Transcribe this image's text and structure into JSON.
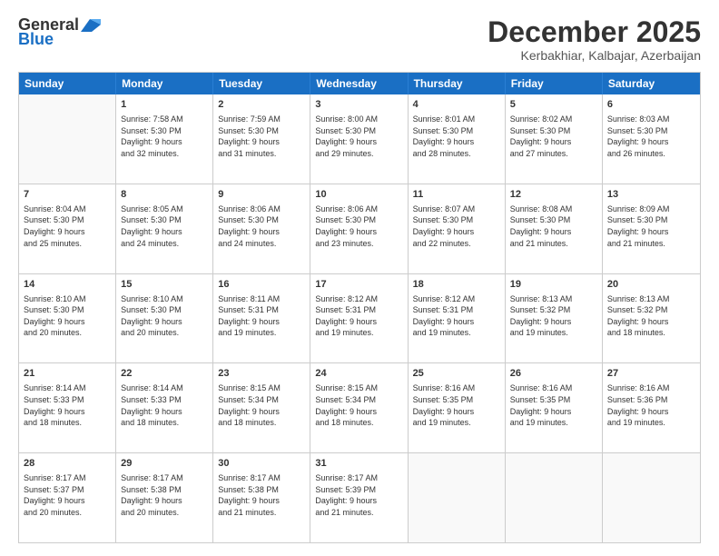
{
  "logo": {
    "general": "General",
    "blue": "Blue"
  },
  "title": "December 2025",
  "subtitle": "Kerbakhiar, Kalbajar, Azerbaijan",
  "days": [
    "Sunday",
    "Monday",
    "Tuesday",
    "Wednesday",
    "Thursday",
    "Friday",
    "Saturday"
  ],
  "weeks": [
    [
      {
        "day": "",
        "info": ""
      },
      {
        "day": "1",
        "info": "Sunrise: 7:58 AM\nSunset: 5:30 PM\nDaylight: 9 hours\nand 32 minutes."
      },
      {
        "day": "2",
        "info": "Sunrise: 7:59 AM\nSunset: 5:30 PM\nDaylight: 9 hours\nand 31 minutes."
      },
      {
        "day": "3",
        "info": "Sunrise: 8:00 AM\nSunset: 5:30 PM\nDaylight: 9 hours\nand 29 minutes."
      },
      {
        "day": "4",
        "info": "Sunrise: 8:01 AM\nSunset: 5:30 PM\nDaylight: 9 hours\nand 28 minutes."
      },
      {
        "day": "5",
        "info": "Sunrise: 8:02 AM\nSunset: 5:30 PM\nDaylight: 9 hours\nand 27 minutes."
      },
      {
        "day": "6",
        "info": "Sunrise: 8:03 AM\nSunset: 5:30 PM\nDaylight: 9 hours\nand 26 minutes."
      }
    ],
    [
      {
        "day": "7",
        "info": "Sunrise: 8:04 AM\nSunset: 5:30 PM\nDaylight: 9 hours\nand 25 minutes."
      },
      {
        "day": "8",
        "info": "Sunrise: 8:05 AM\nSunset: 5:30 PM\nDaylight: 9 hours\nand 24 minutes."
      },
      {
        "day": "9",
        "info": "Sunrise: 8:06 AM\nSunset: 5:30 PM\nDaylight: 9 hours\nand 24 minutes."
      },
      {
        "day": "10",
        "info": "Sunrise: 8:06 AM\nSunset: 5:30 PM\nDaylight: 9 hours\nand 23 minutes."
      },
      {
        "day": "11",
        "info": "Sunrise: 8:07 AM\nSunset: 5:30 PM\nDaylight: 9 hours\nand 22 minutes."
      },
      {
        "day": "12",
        "info": "Sunrise: 8:08 AM\nSunset: 5:30 PM\nDaylight: 9 hours\nand 21 minutes."
      },
      {
        "day": "13",
        "info": "Sunrise: 8:09 AM\nSunset: 5:30 PM\nDaylight: 9 hours\nand 21 minutes."
      }
    ],
    [
      {
        "day": "14",
        "info": "Sunrise: 8:10 AM\nSunset: 5:30 PM\nDaylight: 9 hours\nand 20 minutes."
      },
      {
        "day": "15",
        "info": "Sunrise: 8:10 AM\nSunset: 5:30 PM\nDaylight: 9 hours\nand 20 minutes."
      },
      {
        "day": "16",
        "info": "Sunrise: 8:11 AM\nSunset: 5:31 PM\nDaylight: 9 hours\nand 19 minutes."
      },
      {
        "day": "17",
        "info": "Sunrise: 8:12 AM\nSunset: 5:31 PM\nDaylight: 9 hours\nand 19 minutes."
      },
      {
        "day": "18",
        "info": "Sunrise: 8:12 AM\nSunset: 5:31 PM\nDaylight: 9 hours\nand 19 minutes."
      },
      {
        "day": "19",
        "info": "Sunrise: 8:13 AM\nSunset: 5:32 PM\nDaylight: 9 hours\nand 19 minutes."
      },
      {
        "day": "20",
        "info": "Sunrise: 8:13 AM\nSunset: 5:32 PM\nDaylight: 9 hours\nand 18 minutes."
      }
    ],
    [
      {
        "day": "21",
        "info": "Sunrise: 8:14 AM\nSunset: 5:33 PM\nDaylight: 9 hours\nand 18 minutes."
      },
      {
        "day": "22",
        "info": "Sunrise: 8:14 AM\nSunset: 5:33 PM\nDaylight: 9 hours\nand 18 minutes."
      },
      {
        "day": "23",
        "info": "Sunrise: 8:15 AM\nSunset: 5:34 PM\nDaylight: 9 hours\nand 18 minutes."
      },
      {
        "day": "24",
        "info": "Sunrise: 8:15 AM\nSunset: 5:34 PM\nDaylight: 9 hours\nand 18 minutes."
      },
      {
        "day": "25",
        "info": "Sunrise: 8:16 AM\nSunset: 5:35 PM\nDaylight: 9 hours\nand 19 minutes."
      },
      {
        "day": "26",
        "info": "Sunrise: 8:16 AM\nSunset: 5:35 PM\nDaylight: 9 hours\nand 19 minutes."
      },
      {
        "day": "27",
        "info": "Sunrise: 8:16 AM\nSunset: 5:36 PM\nDaylight: 9 hours\nand 19 minutes."
      }
    ],
    [
      {
        "day": "28",
        "info": "Sunrise: 8:17 AM\nSunset: 5:37 PM\nDaylight: 9 hours\nand 20 minutes."
      },
      {
        "day": "29",
        "info": "Sunrise: 8:17 AM\nSunset: 5:38 PM\nDaylight: 9 hours\nand 20 minutes."
      },
      {
        "day": "30",
        "info": "Sunrise: 8:17 AM\nSunset: 5:38 PM\nDaylight: 9 hours\nand 21 minutes."
      },
      {
        "day": "31",
        "info": "Sunrise: 8:17 AM\nSunset: 5:39 PM\nDaylight: 9 hours\nand 21 minutes."
      },
      {
        "day": "",
        "info": ""
      },
      {
        "day": "",
        "info": ""
      },
      {
        "day": "",
        "info": ""
      }
    ]
  ]
}
